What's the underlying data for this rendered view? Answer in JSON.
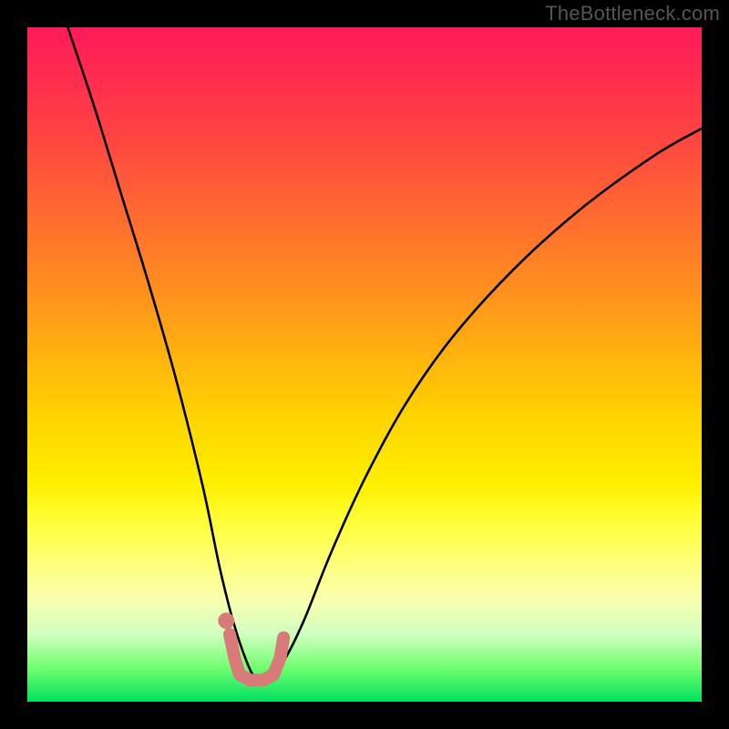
{
  "watermark": "TheBottleneck.com",
  "chart_data": {
    "type": "line",
    "title": "",
    "xlabel": "",
    "ylabel": "",
    "xlim": [
      0,
      100
    ],
    "ylim": [
      0,
      100
    ],
    "grid": false,
    "series": [
      {
        "name": "bottleneck-curve",
        "x": [
          6,
          10,
          14,
          18,
          22,
          26,
          28.5,
          30.5,
          32.5,
          34,
          35.5,
          38,
          41,
          45,
          50,
          56,
          63,
          72,
          82,
          93,
          100
        ],
        "y": [
          100,
          88,
          75,
          62,
          48,
          32,
          20,
          12,
          6,
          3.2,
          3.2,
          6,
          12,
          22,
          33,
          44,
          54,
          64,
          73,
          81,
          85
        ]
      }
    ],
    "bracket_marker": {
      "left_dot": {
        "x": 29.5,
        "y": 12
      },
      "stroke": [
        {
          "x": 30.0,
          "y": 10
        },
        {
          "x": 30.8,
          "y": 6.2
        },
        {
          "x": 31.5,
          "y": 4.0
        },
        {
          "x": 33.0,
          "y": 3.2
        },
        {
          "x": 35.0,
          "y": 3.2
        },
        {
          "x": 36.5,
          "y": 4.0
        },
        {
          "x": 37.5,
          "y": 6.5
        },
        {
          "x": 38.0,
          "y": 9.5
        }
      ]
    },
    "background_gradient": {
      "top": "#ff1a58",
      "mid": "#ffd400",
      "bottom": "#00e060"
    }
  }
}
